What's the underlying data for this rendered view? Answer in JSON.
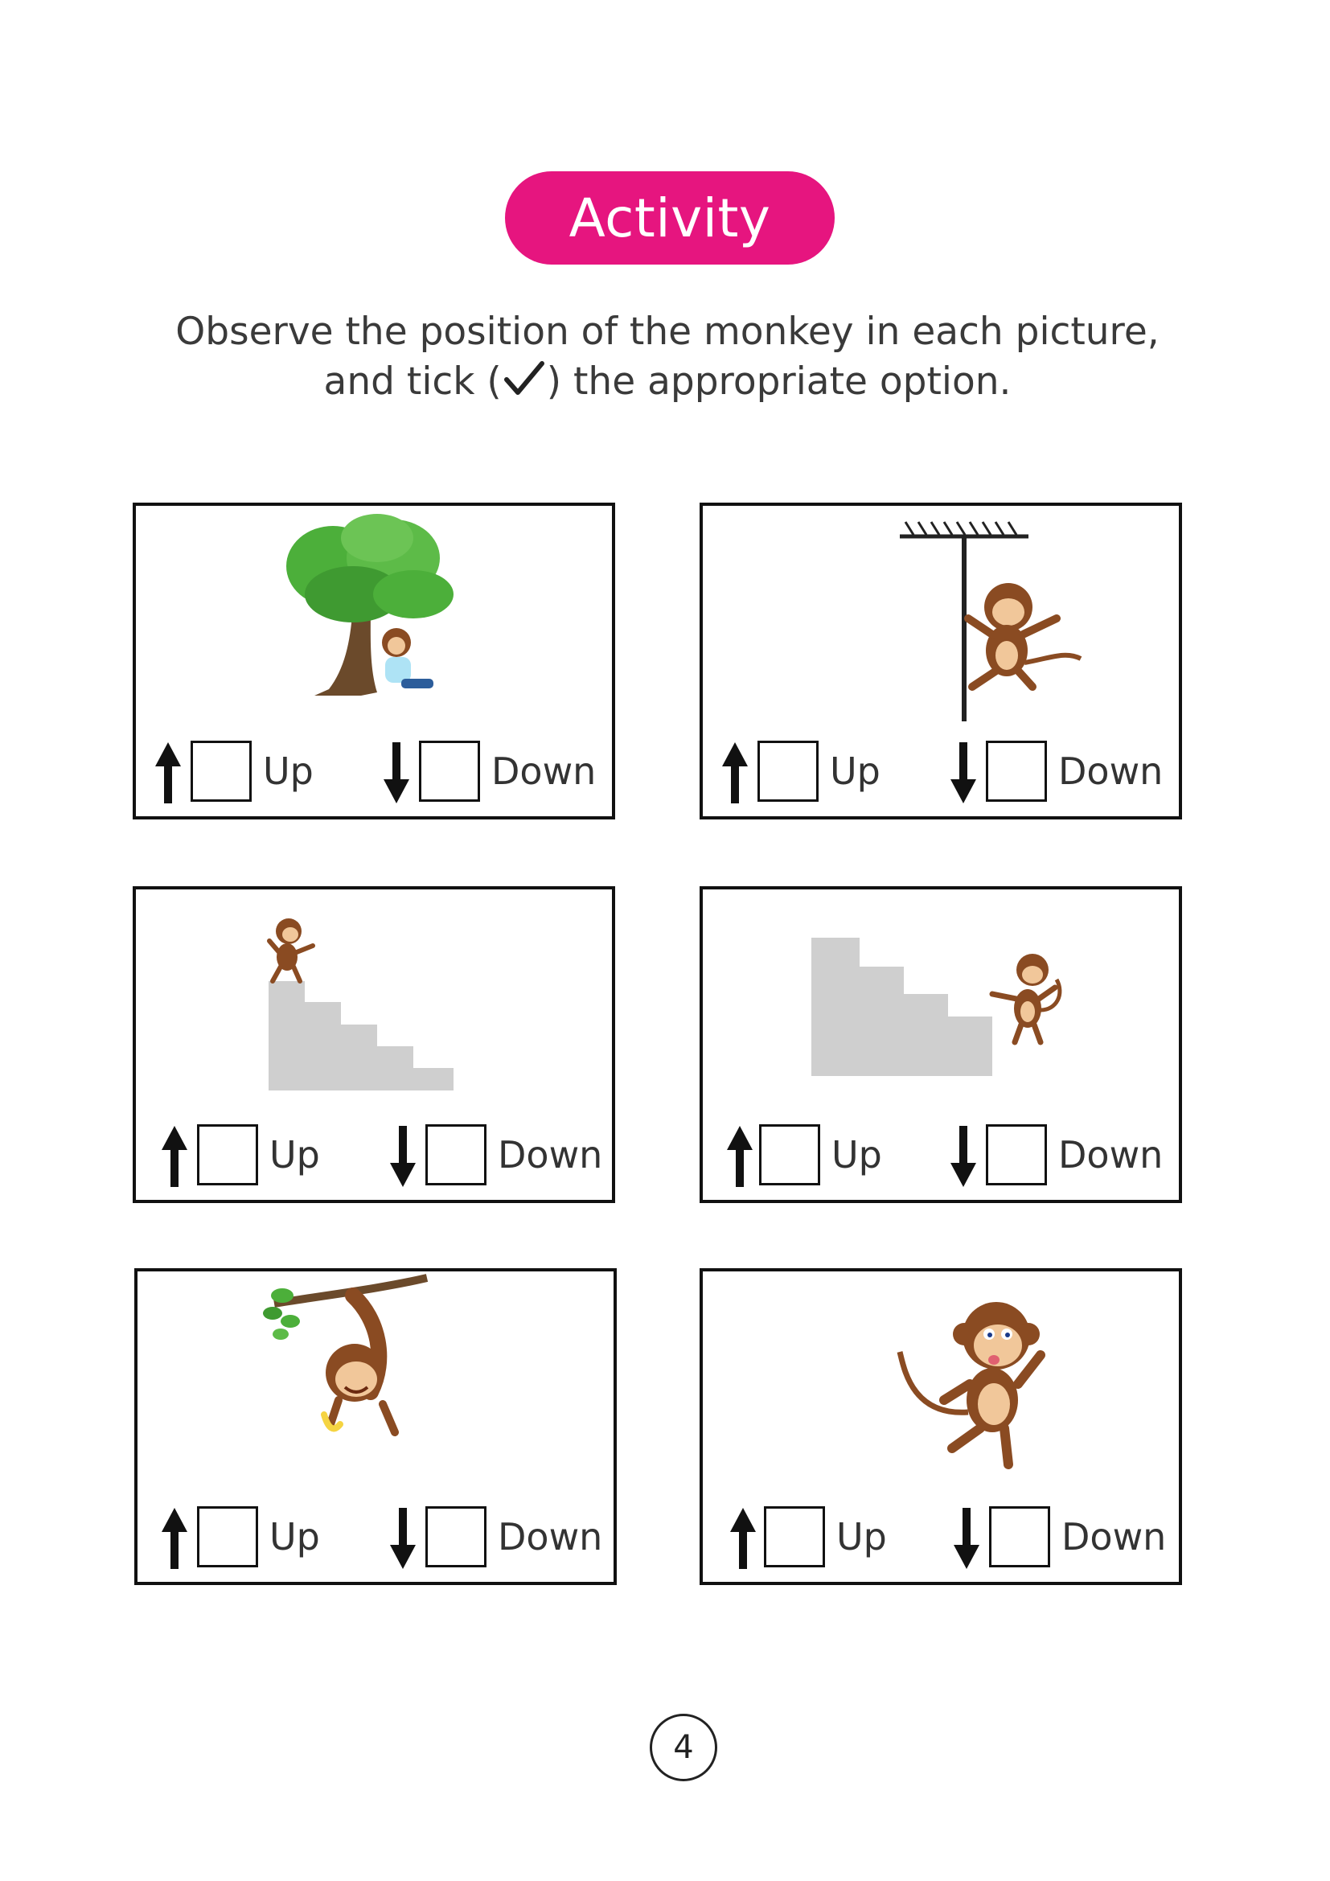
{
  "header": {
    "title": "Activity",
    "instruction_line1": "Observe the position of the monkey in each picture,",
    "instruction_line2_before": "and tick (",
    "instruction_line2_after": ") the appropriate option."
  },
  "cards": [
    {
      "scene": "monkey sitting under a tree",
      "up_label": "Up",
      "down_label": "Down"
    },
    {
      "scene": "monkey climbing a pole",
      "up_label": "Up",
      "down_label": "Down"
    },
    {
      "scene": "monkey on top of stairs",
      "up_label": "Up",
      "down_label": "Down"
    },
    {
      "scene": "monkey at bottom of stairs",
      "up_label": "Up",
      "down_label": "Down"
    },
    {
      "scene": "monkey hanging from a branch",
      "up_label": "Up",
      "down_label": "Down"
    },
    {
      "scene": "monkey standing on ground",
      "up_label": "Up",
      "down_label": "Down"
    }
  ],
  "footer": {
    "page_number": "4"
  },
  "colors": {
    "accent": "#e6157f",
    "stairs": "#cfcfcf",
    "monkey": "#8a4b22",
    "tree": "#4caf3a"
  },
  "icons": [
    "checkmark-icon",
    "up-arrow-icon",
    "down-arrow-icon"
  ]
}
